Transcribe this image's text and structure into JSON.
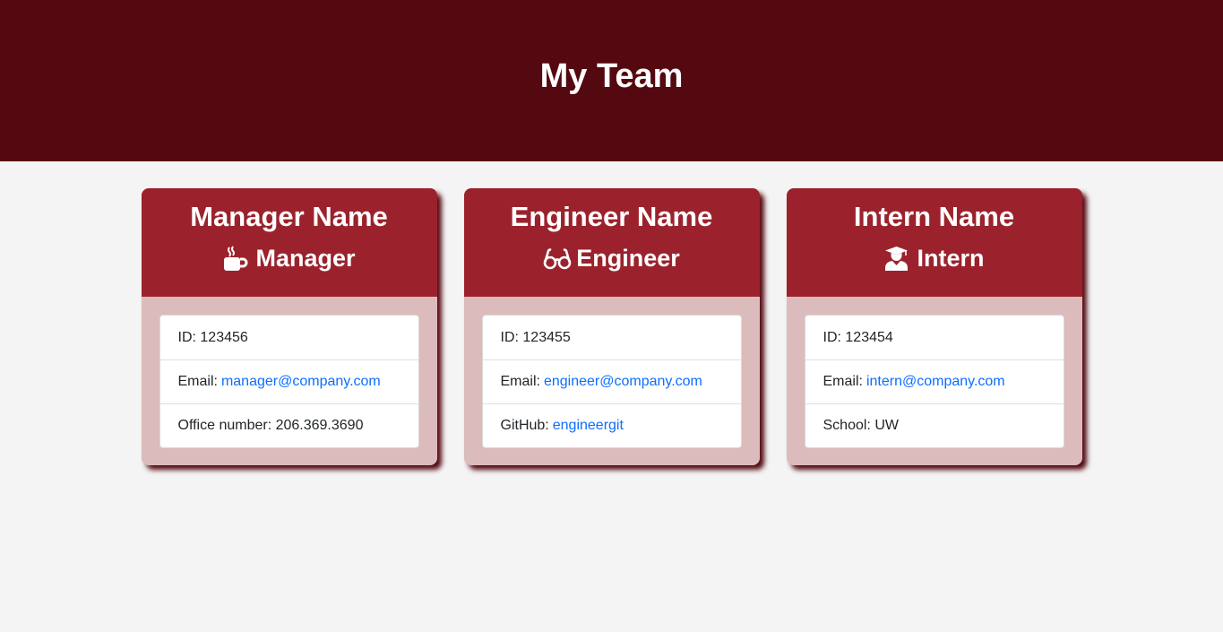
{
  "header": {
    "title": "My Team"
  },
  "colors": {
    "header_bg": "#540810",
    "card_head_bg": "#9b222c",
    "card_body_bg": "#dbbbbc",
    "link": "#0d6efd",
    "page_bg": "#f4f4f4"
  },
  "cards": [
    {
      "name": "Manager Name",
      "role": "Manager",
      "icon": "mug-icon",
      "id_label": "ID: 123456",
      "email_label": "Email:",
      "email": "manager@company.com",
      "extra_label": "Office number: 206.369.3690",
      "extra_link": ""
    },
    {
      "name": "Engineer Name",
      "role": "Engineer",
      "icon": "glasses-icon",
      "id_label": "ID: 123455",
      "email_label": "Email:",
      "email": "engineer@company.com",
      "extra_label": "GitHub:",
      "extra_link": "engineergit"
    },
    {
      "name": "Intern Name",
      "role": "Intern",
      "icon": "graduate-icon",
      "id_label": "ID: 123454",
      "email_label": "Email:",
      "email": "intern@company.com",
      "extra_label": "School: UW",
      "extra_link": ""
    }
  ]
}
